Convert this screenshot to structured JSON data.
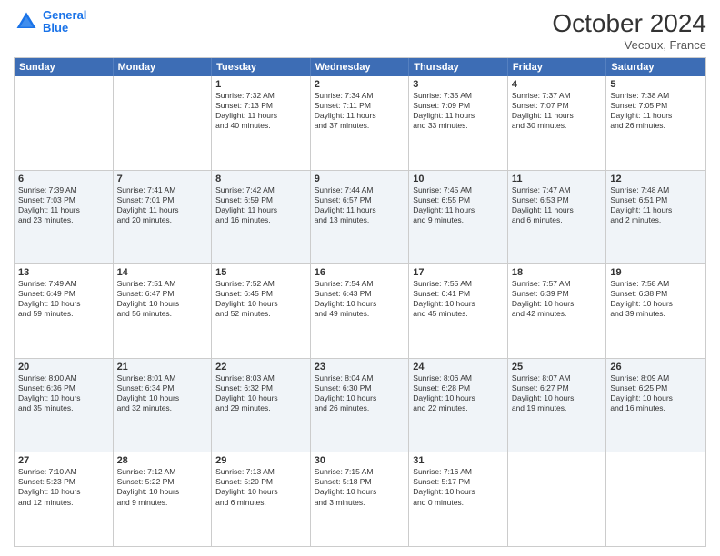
{
  "logo": {
    "line1": "General",
    "line2": "Blue"
  },
  "title": "October 2024",
  "location": "Vecoux, France",
  "days_of_week": [
    "Sunday",
    "Monday",
    "Tuesday",
    "Wednesday",
    "Thursday",
    "Friday",
    "Saturday"
  ],
  "weeks": [
    {
      "alt": false,
      "cells": [
        {
          "day": "",
          "info": ""
        },
        {
          "day": "",
          "info": ""
        },
        {
          "day": "1",
          "info": "Sunrise: 7:32 AM\nSunset: 7:13 PM\nDaylight: 11 hours\nand 40 minutes."
        },
        {
          "day": "2",
          "info": "Sunrise: 7:34 AM\nSunset: 7:11 PM\nDaylight: 11 hours\nand 37 minutes."
        },
        {
          "day": "3",
          "info": "Sunrise: 7:35 AM\nSunset: 7:09 PM\nDaylight: 11 hours\nand 33 minutes."
        },
        {
          "day": "4",
          "info": "Sunrise: 7:37 AM\nSunset: 7:07 PM\nDaylight: 11 hours\nand 30 minutes."
        },
        {
          "day": "5",
          "info": "Sunrise: 7:38 AM\nSunset: 7:05 PM\nDaylight: 11 hours\nand 26 minutes."
        }
      ]
    },
    {
      "alt": true,
      "cells": [
        {
          "day": "6",
          "info": "Sunrise: 7:39 AM\nSunset: 7:03 PM\nDaylight: 11 hours\nand 23 minutes."
        },
        {
          "day": "7",
          "info": "Sunrise: 7:41 AM\nSunset: 7:01 PM\nDaylight: 11 hours\nand 20 minutes."
        },
        {
          "day": "8",
          "info": "Sunrise: 7:42 AM\nSunset: 6:59 PM\nDaylight: 11 hours\nand 16 minutes."
        },
        {
          "day": "9",
          "info": "Sunrise: 7:44 AM\nSunset: 6:57 PM\nDaylight: 11 hours\nand 13 minutes."
        },
        {
          "day": "10",
          "info": "Sunrise: 7:45 AM\nSunset: 6:55 PM\nDaylight: 11 hours\nand 9 minutes."
        },
        {
          "day": "11",
          "info": "Sunrise: 7:47 AM\nSunset: 6:53 PM\nDaylight: 11 hours\nand 6 minutes."
        },
        {
          "day": "12",
          "info": "Sunrise: 7:48 AM\nSunset: 6:51 PM\nDaylight: 11 hours\nand 2 minutes."
        }
      ]
    },
    {
      "alt": false,
      "cells": [
        {
          "day": "13",
          "info": "Sunrise: 7:49 AM\nSunset: 6:49 PM\nDaylight: 10 hours\nand 59 minutes."
        },
        {
          "day": "14",
          "info": "Sunrise: 7:51 AM\nSunset: 6:47 PM\nDaylight: 10 hours\nand 56 minutes."
        },
        {
          "day": "15",
          "info": "Sunrise: 7:52 AM\nSunset: 6:45 PM\nDaylight: 10 hours\nand 52 minutes."
        },
        {
          "day": "16",
          "info": "Sunrise: 7:54 AM\nSunset: 6:43 PM\nDaylight: 10 hours\nand 49 minutes."
        },
        {
          "day": "17",
          "info": "Sunrise: 7:55 AM\nSunset: 6:41 PM\nDaylight: 10 hours\nand 45 minutes."
        },
        {
          "day": "18",
          "info": "Sunrise: 7:57 AM\nSunset: 6:39 PM\nDaylight: 10 hours\nand 42 minutes."
        },
        {
          "day": "19",
          "info": "Sunrise: 7:58 AM\nSunset: 6:38 PM\nDaylight: 10 hours\nand 39 minutes."
        }
      ]
    },
    {
      "alt": true,
      "cells": [
        {
          "day": "20",
          "info": "Sunrise: 8:00 AM\nSunset: 6:36 PM\nDaylight: 10 hours\nand 35 minutes."
        },
        {
          "day": "21",
          "info": "Sunrise: 8:01 AM\nSunset: 6:34 PM\nDaylight: 10 hours\nand 32 minutes."
        },
        {
          "day": "22",
          "info": "Sunrise: 8:03 AM\nSunset: 6:32 PM\nDaylight: 10 hours\nand 29 minutes."
        },
        {
          "day": "23",
          "info": "Sunrise: 8:04 AM\nSunset: 6:30 PM\nDaylight: 10 hours\nand 26 minutes."
        },
        {
          "day": "24",
          "info": "Sunrise: 8:06 AM\nSunset: 6:28 PM\nDaylight: 10 hours\nand 22 minutes."
        },
        {
          "day": "25",
          "info": "Sunrise: 8:07 AM\nSunset: 6:27 PM\nDaylight: 10 hours\nand 19 minutes."
        },
        {
          "day": "26",
          "info": "Sunrise: 8:09 AM\nSunset: 6:25 PM\nDaylight: 10 hours\nand 16 minutes."
        }
      ]
    },
    {
      "alt": false,
      "cells": [
        {
          "day": "27",
          "info": "Sunrise: 7:10 AM\nSunset: 5:23 PM\nDaylight: 10 hours\nand 12 minutes."
        },
        {
          "day": "28",
          "info": "Sunrise: 7:12 AM\nSunset: 5:22 PM\nDaylight: 10 hours\nand 9 minutes."
        },
        {
          "day": "29",
          "info": "Sunrise: 7:13 AM\nSunset: 5:20 PM\nDaylight: 10 hours\nand 6 minutes."
        },
        {
          "day": "30",
          "info": "Sunrise: 7:15 AM\nSunset: 5:18 PM\nDaylight: 10 hours\nand 3 minutes."
        },
        {
          "day": "31",
          "info": "Sunrise: 7:16 AM\nSunset: 5:17 PM\nDaylight: 10 hours\nand 0 minutes."
        },
        {
          "day": "",
          "info": ""
        },
        {
          "day": "",
          "info": ""
        }
      ]
    }
  ]
}
